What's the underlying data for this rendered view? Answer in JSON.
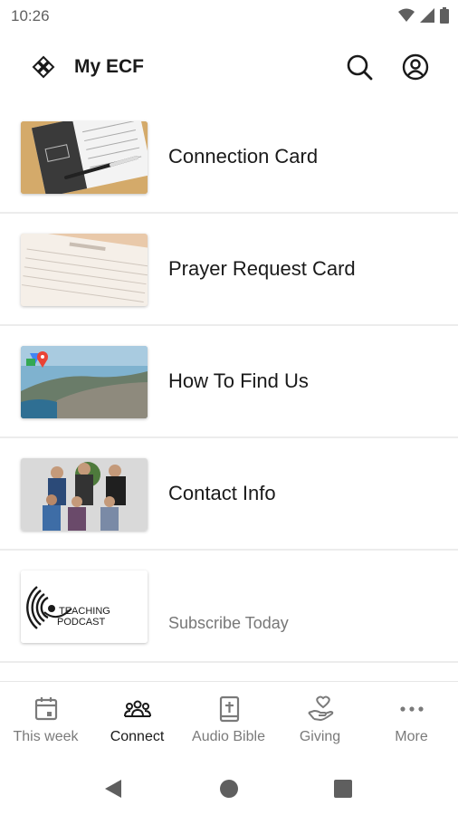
{
  "status_bar": {
    "time": "10:26",
    "icons": [
      "wifi-icon",
      "signal-icon",
      "battery-icon"
    ]
  },
  "header": {
    "title": "My ECF",
    "logo": "ecf-logo-icon",
    "search_icon": "search-icon",
    "profile_icon": "account-icon"
  },
  "items": [
    {
      "label": "Connection Card",
      "thumbnail": "connection-card-photo"
    },
    {
      "label": "Prayer Request Card",
      "thumbnail": "prayer-request-photo"
    },
    {
      "label": "How To Find Us",
      "thumbnail": "city-map-photo"
    },
    {
      "label": "Contact Info",
      "thumbnail": "staff-group-photo"
    },
    {
      "label": "Subscribe Today",
      "thumbnail": "teaching-podcast-logo",
      "thumb_text": [
        "TEACHING",
        "PODCAST"
      ]
    }
  ],
  "tabs": [
    {
      "label": "This week",
      "icon": "calendar-icon",
      "active": false
    },
    {
      "label": "Connect",
      "icon": "people-icon",
      "active": true
    },
    {
      "label": "Audio Bible",
      "icon": "bible-icon",
      "active": false
    },
    {
      "label": "Giving",
      "icon": "giving-hand-icon",
      "active": false
    },
    {
      "label": "More",
      "icon": "more-dots-icon",
      "active": false
    }
  ],
  "nav": [
    "back-icon",
    "home-icon",
    "recents-icon"
  ],
  "colors": {
    "text": "#1a1a1a",
    "muted": "#7a7a7a",
    "divider": "#ececec"
  }
}
